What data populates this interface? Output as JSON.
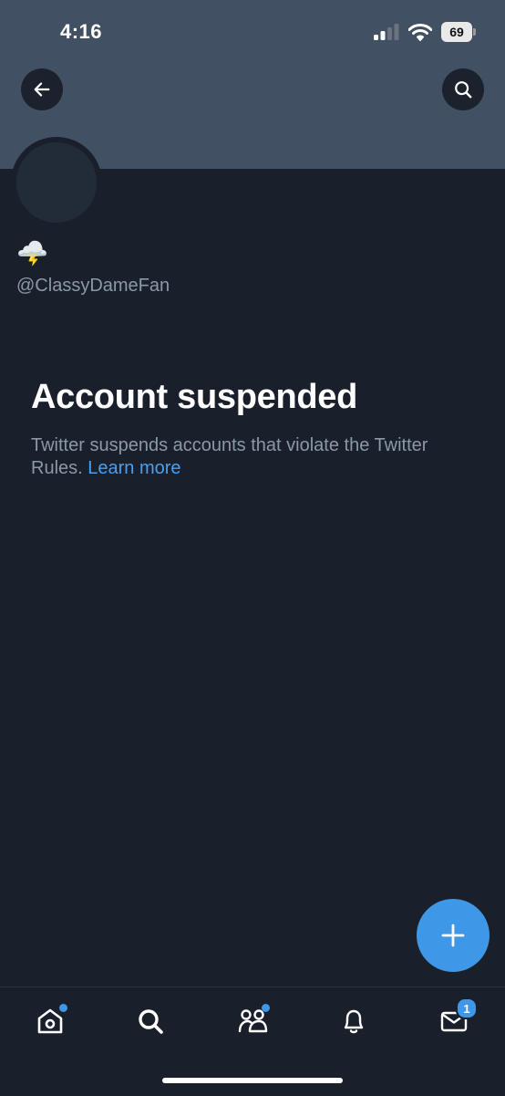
{
  "status_bar": {
    "time": "4:16",
    "battery": "69",
    "signal_icon": "cellular-signal-icon",
    "wifi_icon": "wifi-icon"
  },
  "header": {
    "back_icon": "arrow-left-icon",
    "search_icon": "search-icon"
  },
  "profile": {
    "display_name": "🌩️",
    "handle": "@ClassyDameFan"
  },
  "suspension": {
    "title": "Account suspended",
    "message": "Twitter suspends accounts that violate the Twitter Rules.",
    "link_text": "Learn more"
  },
  "fab": {
    "icon": "plus-icon"
  },
  "tab_bar": {
    "items": [
      {
        "name": "home",
        "icon": "home-icon",
        "has_dot": true
      },
      {
        "name": "search",
        "icon": "search-icon"
      },
      {
        "name": "communities",
        "icon": "communities-icon",
        "has_dot": true
      },
      {
        "name": "notifications",
        "icon": "bell-icon"
      },
      {
        "name": "messages",
        "icon": "envelope-icon",
        "badge": "1"
      }
    ]
  },
  "colors": {
    "background": "#1a202b",
    "banner": "#425063",
    "accent": "#3f97e8",
    "secondary_text": "#8b98a5"
  }
}
